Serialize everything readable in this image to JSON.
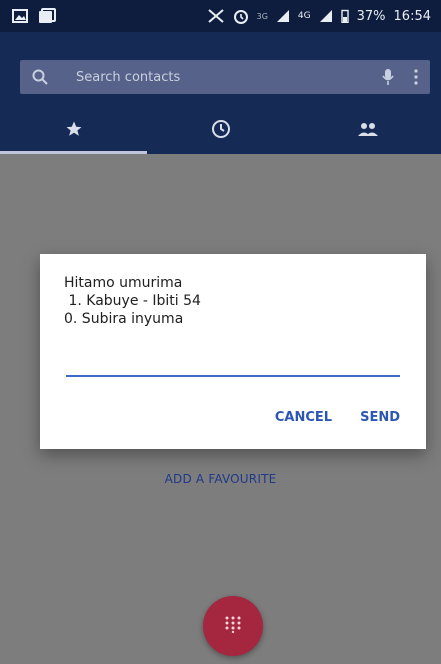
{
  "status_bar": {
    "network_3g": "3G",
    "network_4g": "4G",
    "battery_percent": "37%",
    "time": "16:54"
  },
  "search": {
    "placeholder": "Search contacts"
  },
  "tabs": [
    {
      "name": "favorites",
      "icon": "star-icon",
      "active": true
    },
    {
      "name": "recents",
      "icon": "clock-icon",
      "active": false
    },
    {
      "name": "contacts",
      "icon": "people-icon",
      "active": false
    }
  ],
  "dialog": {
    "lines": [
      "Hitamo umurima",
      " 1. Kabuye - Ibiti 54",
      "0. Subira inyuma"
    ],
    "input_value": "",
    "cancel_label": "CANCEL",
    "send_label": "SEND"
  },
  "content": {
    "add_favourite_label": "ADD A FAVOURITE"
  },
  "colors": {
    "header": "#162a56",
    "status_bar": "#0e1d3e",
    "accent": "#2c56b4",
    "fab": "#a4263f"
  }
}
